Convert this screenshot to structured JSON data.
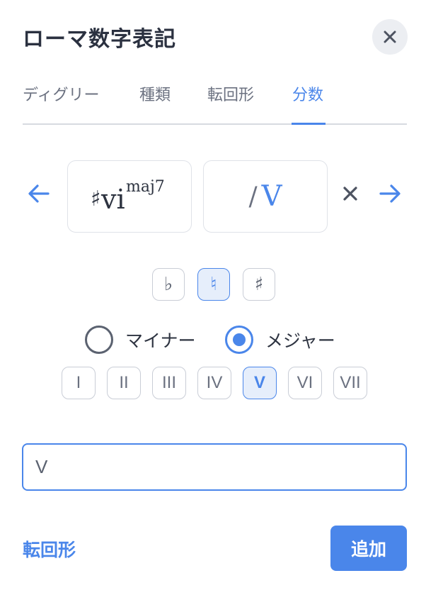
{
  "dialog": {
    "title": "ローマ数字表記"
  },
  "tabs": [
    {
      "label": "ディグリー",
      "active": false
    },
    {
      "label": "種類",
      "active": false
    },
    {
      "label": "転回形",
      "active": false
    },
    {
      "label": "分数",
      "active": true
    }
  ],
  "chord": {
    "accidental": "♯",
    "numeral": "vi",
    "quality": "maj7",
    "bass_slash": "/",
    "bass_numeral": "V"
  },
  "accidentals": [
    {
      "symbol": "♭",
      "selected": false
    },
    {
      "symbol": "♮",
      "selected": true
    },
    {
      "symbol": "♯",
      "selected": false
    }
  ],
  "mode": {
    "minor_label": "マイナー",
    "major_label": "メジャー",
    "selected": "major"
  },
  "numerals": [
    {
      "label": "I",
      "selected": false
    },
    {
      "label": "II",
      "selected": false
    },
    {
      "label": "III",
      "selected": false
    },
    {
      "label": "IV",
      "selected": false
    },
    {
      "label": "V",
      "selected": true
    },
    {
      "label": "VI",
      "selected": false
    },
    {
      "label": "VII",
      "selected": false
    }
  ],
  "input": {
    "value": "V"
  },
  "footer": {
    "inversion_link": "転回形",
    "add_label": "追加"
  },
  "icons": {
    "close": "close-icon",
    "prev": "arrow-left-icon",
    "next": "arrow-right-icon",
    "remove": "remove-icon"
  },
  "colors": {
    "accent": "#4a86ea",
    "text": "#2d3340",
    "muted": "#6b7180"
  }
}
